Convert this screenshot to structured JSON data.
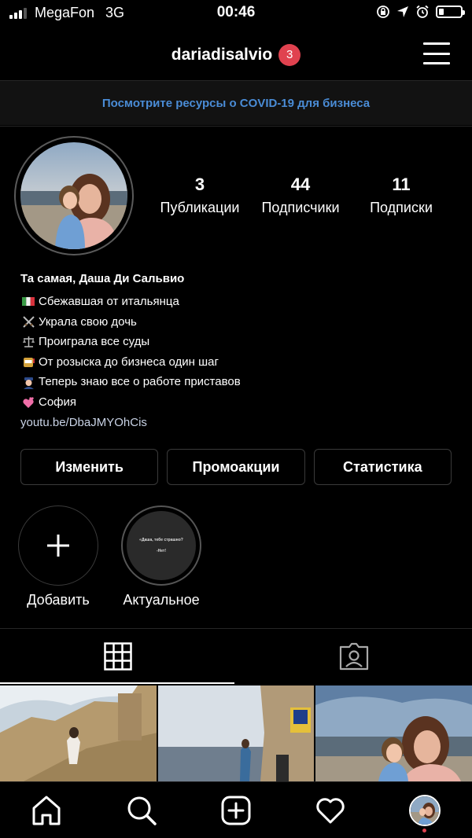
{
  "status_bar": {
    "carrier": "MegaFon",
    "network": "3G",
    "time": "00:46"
  },
  "header": {
    "username": "dariadisalvio",
    "notification_count": "3"
  },
  "covid_banner": {
    "text": "Посмотрите ресурсы о COVID-19 для бизнеса"
  },
  "profile": {
    "stats": [
      {
        "value": "3",
        "label": "Публикации"
      },
      {
        "value": "44",
        "label": "Подписчики"
      },
      {
        "value": "11",
        "label": "Подписки"
      }
    ],
    "bio": {
      "name": "Та самая, Даша Ди Сальвио",
      "lines": [
        {
          "icon": "italy-flag-icon",
          "text": "Сбежавшая от итальянца"
        },
        {
          "icon": "crossed-swords-icon",
          "text": "Украла свою дочь"
        },
        {
          "icon": "balance-scale-icon",
          "text": "Проиграла все суды"
        },
        {
          "icon": "slot-machine-icon",
          "text": "От розыска до бизнеса один шаг"
        },
        {
          "icon": "police-officer-icon",
          "text": "Теперь знаю все о работе приставов"
        },
        {
          "icon": "two-hearts-icon",
          "text": "София"
        }
      ],
      "link": "youtu.be/DbaJMYOhCis"
    }
  },
  "actions": {
    "edit": "Изменить",
    "promotions": "Промоакции",
    "statistics": "Статистика"
  },
  "highlights": {
    "add_label": "Добавить",
    "items": [
      {
        "label": "Актуальное",
        "cover_lines": [
          "«Даша, тебе страшно?",
          "-Нет!"
        ]
      }
    ]
  },
  "tabs": {
    "active": "grid",
    "items": [
      "grid-icon",
      "tagged-icon"
    ]
  },
  "bottom_nav": {
    "items": [
      "home-icon",
      "search-icon",
      "new-post-icon",
      "activity-heart-icon",
      "profile-avatar"
    ]
  },
  "colors": {
    "accent_link": "#4a8cd6",
    "badge": "#e0424f",
    "background": "#000000"
  }
}
